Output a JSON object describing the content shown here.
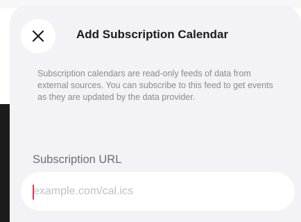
{
  "header": {
    "title": "Add Subscription Calendar",
    "close_icon": "close-icon"
  },
  "description": "Subscription calendars are read-only feeds of data from external sources. You can subscribe to this feed to get events as they are updated by the data provider.",
  "subscription_url": {
    "label": "Subscription URL",
    "value": "",
    "placeholder": "example.com/cal.ics"
  },
  "colors": {
    "sheet_background": "#f2f2f7",
    "caret": "#e8344a"
  }
}
